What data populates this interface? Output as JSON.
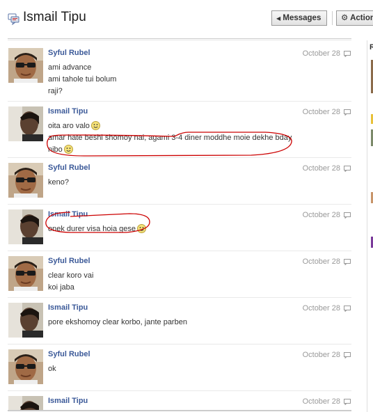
{
  "page": {
    "title": "Ismail Tipu",
    "messages_button": "Messages",
    "actions_button": "Actions"
  },
  "sidebar_right": {
    "letter": "R"
  },
  "messages": [
    {
      "sender": "Syful Rubel",
      "date": "October 28",
      "lines": [
        "ami advance",
        "ami tahole tui bolum",
        "raji?"
      ]
    },
    {
      "sender": "Ismail Tipu",
      "date": "October 28",
      "lines": [
        "oita aro valo",
        "amar hate beshi shomoy nai, agami 3-4 diner moddhe moie dekhe bday",
        "nibo"
      ]
    },
    {
      "sender": "Syful Rubel",
      "date": "October 28",
      "lines": [
        "keno?"
      ]
    },
    {
      "sender": "Ismail Tipu",
      "date": "October 28",
      "lines": [
        "onek durer visa hoia gese"
      ]
    },
    {
      "sender": "Syful Rubel",
      "date": "October 28",
      "lines": [
        "clear koro vai",
        "koi jaba"
      ]
    },
    {
      "sender": "Ismail Tipu",
      "date": "October 28",
      "lines": [
        "pore ekshomoy clear korbo, jante parben"
      ]
    },
    {
      "sender": "Syful Rubel",
      "date": "October 28",
      "lines": [
        "ok"
      ]
    },
    {
      "sender": "Ismail Tipu",
      "date": "October 28",
      "lines": []
    }
  ],
  "colors": {
    "link": "#3b5998",
    "annotation": "#cc0000"
  }
}
